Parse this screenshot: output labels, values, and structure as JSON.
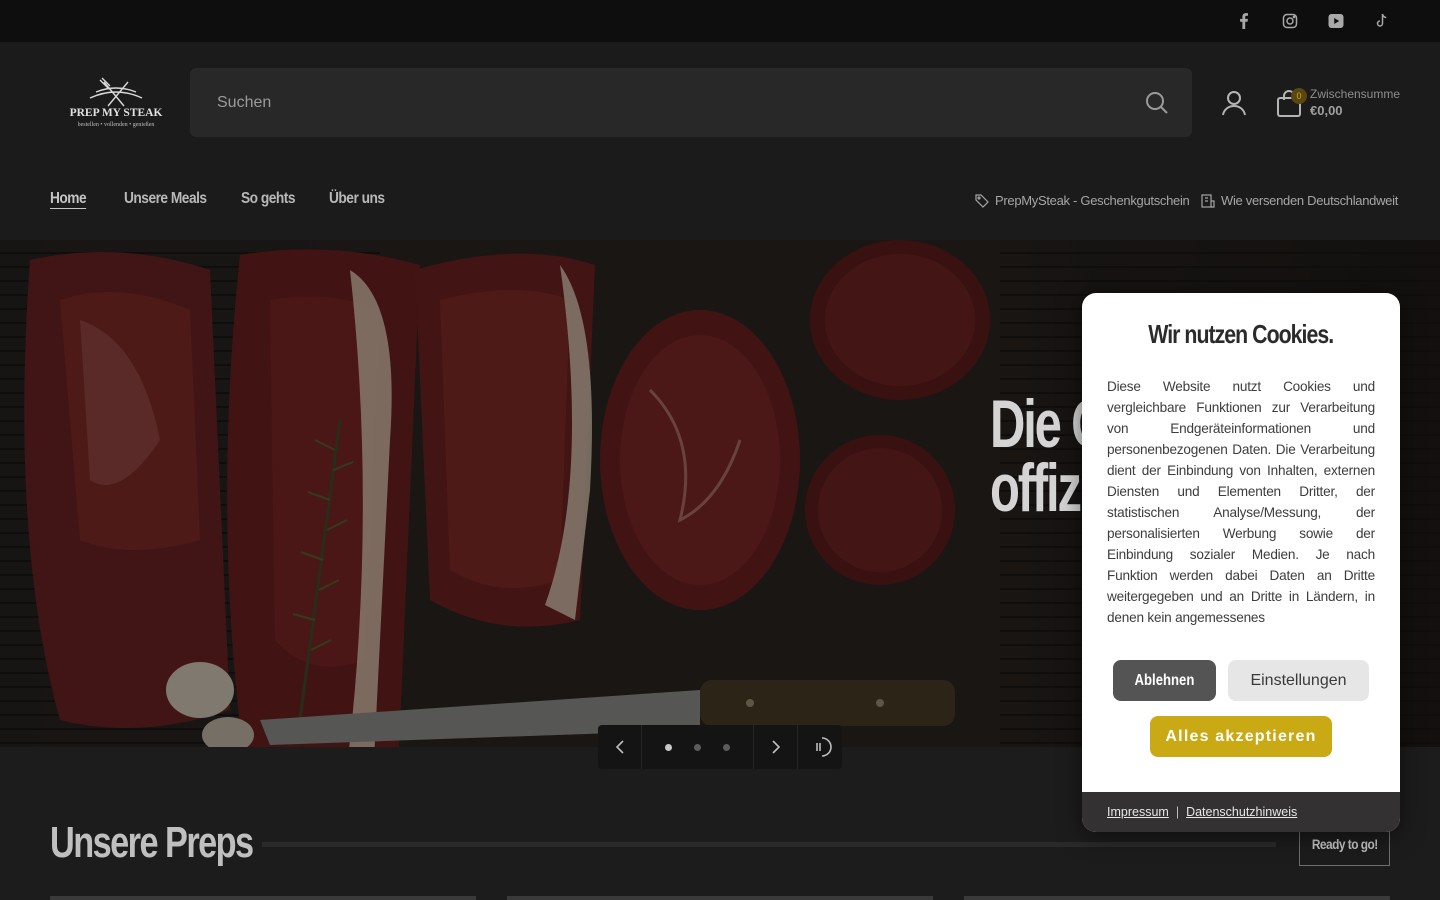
{
  "topbar": {
    "social": [
      {
        "name": "facebook-icon"
      },
      {
        "name": "instagram-icon"
      },
      {
        "name": "youtube-icon"
      },
      {
        "name": "tiktok-icon"
      }
    ]
  },
  "header": {
    "logo_name": "PREP MY STEAK",
    "logo_tagline": "bestellen • vollenden • genießen",
    "search_placeholder": "Suchen",
    "cart": {
      "count": "0",
      "subtotal_label": "Zwischensumme",
      "subtotal_value": "€0,00"
    }
  },
  "nav": {
    "items": [
      {
        "label": "Home",
        "active": true
      },
      {
        "label": "Unsere Meals"
      },
      {
        "label": "So gehts"
      },
      {
        "label": "Über uns"
      }
    ],
    "links": [
      {
        "label": "PrepMySteak - Geschenkgutschein",
        "icon": "tag-icon"
      },
      {
        "label": "Wie versenden Deutschlandweit",
        "icon": "shipping-icon"
      }
    ]
  },
  "hero": {
    "title_line1": "Die O",
    "title_line2": "offiz"
  },
  "slider": {
    "slides": 3,
    "active": 0
  },
  "section": {
    "title": "Unsere Preps",
    "button": "Ready to go!"
  },
  "cookie": {
    "title": "Wir nutzen Cookies.",
    "text": "Diese Website nutzt Cookies und vergleichbare Funktionen zur Verarbeitung von Endgeräteinformationen und personenbezogenen Daten. Die Verarbeitung dient der Einbindung von Inhalten, externen Diensten und Elementen Dritter, der statistischen Analyse/Messung, der personalisierten Werbung sowie der Einbindung sozialer Medien. Je nach Funktion werden dabei Daten an Dritte weitergegeben und an Dritte in Ländern, in denen kein angemessenes",
    "decline": "Ablehnen",
    "settings": "Einstellungen",
    "accept": "Alles akzeptieren",
    "footer": {
      "imprint": "Impressum",
      "separator": "|",
      "privacy": "Datenschutzhinweis"
    }
  },
  "colors": {
    "accent": "#c9a914",
    "background": "#1c1c1c",
    "topbar": "#0e0e0e"
  }
}
